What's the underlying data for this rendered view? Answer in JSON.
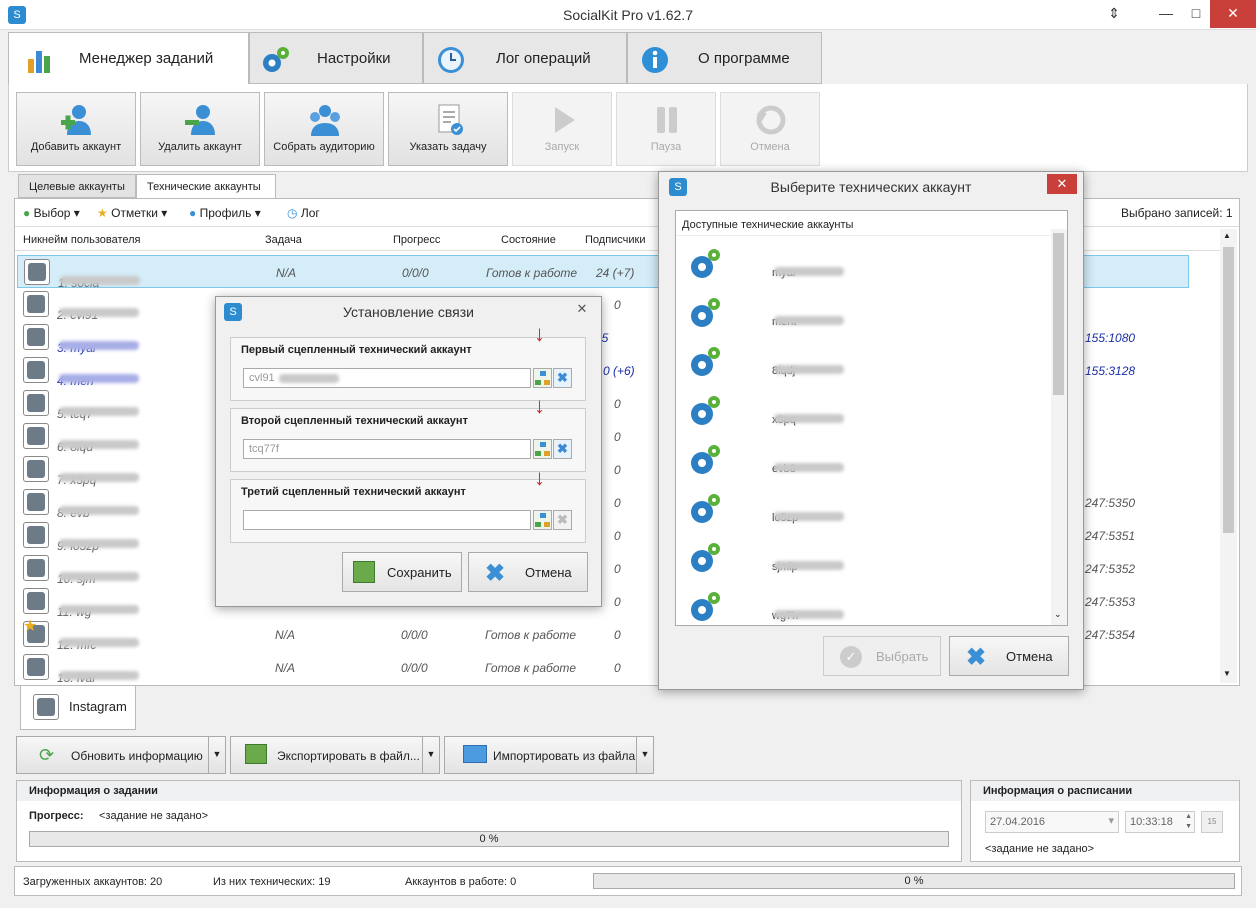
{
  "window": {
    "title": "SocialKit Pro v1.62.7",
    "restore_glyph": "⇕",
    "minimize_glyph": "—",
    "maximize_glyph": "□",
    "close_glyph": "✕"
  },
  "main_tabs": [
    {
      "label": "Менеджер заданий",
      "icon": "chart-icon"
    },
    {
      "label": "Настройки",
      "icon": "gears-icon"
    },
    {
      "label": "Лог операций",
      "icon": "clock-icon"
    },
    {
      "label": "О программе",
      "icon": "info-icon"
    }
  ],
  "toolbar": [
    {
      "label": "Добавить аккаунт",
      "enabled": true
    },
    {
      "label": "Удалить аккаунт",
      "enabled": true
    },
    {
      "label": "Собрать аудиторию",
      "enabled": true
    },
    {
      "label": "Указать задачу",
      "enabled": true
    },
    {
      "label": "Запуск",
      "enabled": false
    },
    {
      "label": "Пауза",
      "enabled": false
    },
    {
      "label": "Отмена",
      "enabled": false
    }
  ],
  "sub_tabs": [
    "Целевые аккаунты",
    "Технические аккаунты"
  ],
  "filter": {
    "select": "Выбор",
    "marks": "Отметки",
    "profile": "Профиль",
    "log": "Лог",
    "selected_count": "Выбрано записей: 1"
  },
  "columns": {
    "nick": "Никнейм пользователя",
    "task": "Задача",
    "progress": "Прогресс",
    "state": "Состояние",
    "subs": "Подписчики"
  },
  "rows": [
    {
      "nick": "1. socia",
      "task": "N/A",
      "progress": "0/0/0",
      "state": "Готов к работе",
      "subs": "24 (+7)",
      "extra": ""
    },
    {
      "nick": "2. cvl91",
      "task": "",
      "progress": "",
      "state": "",
      "subs": "0",
      "extra": ""
    },
    {
      "nick": "3. myar",
      "task": "",
      "progress": "",
      "state": "",
      "subs": "15",
      "extra": "155:1080"
    },
    {
      "nick": "4. men",
      "task": "",
      "progress": "",
      "state": "",
      "subs": "0 (+6)",
      "extra": "155:3128"
    },
    {
      "nick": "5. tcq7",
      "task": "",
      "progress": "",
      "state": "",
      "subs": "0",
      "extra": ""
    },
    {
      "nick": "6. 8iqd",
      "task": "",
      "progress": "",
      "state": "",
      "subs": "0",
      "extra": ""
    },
    {
      "nick": "7. x3pq",
      "task": "",
      "progress": "",
      "state": "",
      "subs": "0",
      "extra": ""
    },
    {
      "nick": "8. evb",
      "task": "",
      "progress": "",
      "state": "",
      "subs": "0",
      "extra": "247:5350"
    },
    {
      "nick": "9. lo5zp",
      "task": "",
      "progress": "",
      "state": "",
      "subs": "0",
      "extra": "247:5351"
    },
    {
      "nick": "10. sjm",
      "task": "",
      "progress": "",
      "state": "",
      "subs": "0",
      "extra": "247:5352"
    },
    {
      "nick": "11. wg",
      "task": "",
      "progress": "",
      "state": "",
      "subs": "0",
      "extra": "247:5353"
    },
    {
      "nick": "12. mfc",
      "task": "N/A",
      "progress": "0/0/0",
      "state": "Готов к работе",
      "subs": "0",
      "extra": "247:5354"
    },
    {
      "nick": "13. ivar",
      "task": "N/A",
      "progress": "0/0/0",
      "state": "Готов к работе",
      "subs": "0",
      "extra": ""
    }
  ],
  "platform_tab": "Instagram",
  "bottom_buttons": [
    "Обновить информацию",
    "Экспортировать в файл...",
    "Импортировать из файла"
  ],
  "task_info": {
    "title": "Информация о задании",
    "progress_label": "Прогресс:",
    "progress_value": "<задание не задано>",
    "percent": "0 %"
  },
  "schedule_info": {
    "title": "Информация о расписании",
    "date": "27.04.2016",
    "time": "10:33:18",
    "calendar_day": "15",
    "status": "<задание не задано>"
  },
  "status_bar": {
    "loaded": "Загруженных аккаунтов: 20",
    "technical": "Из них технических: 19",
    "working": "Аккаунтов в работе: 0",
    "percent": "0 %"
  },
  "link_dialog": {
    "title": "Установление связи",
    "first_label": "Первый сцепленный технический аккаунт",
    "first_value": "cvl91",
    "second_label": "Второй сцепленный технический аккаунт",
    "second_value": "tcq77f",
    "third_label": "Третий сцепленный технический аккаунт",
    "third_value": "",
    "save": "Сохранить",
    "cancel": "Отмена"
  },
  "select_dialog": {
    "title": "Выберите технических аккаунт",
    "list_header": "Доступные технические аккаунты",
    "accounts": [
      "myar",
      "ment",
      "8iqdj",
      "x3pq",
      "evb8",
      "lo5zp",
      "sjmip",
      "wg7h"
    ],
    "select": "Выбрать",
    "cancel": "Отмена"
  }
}
